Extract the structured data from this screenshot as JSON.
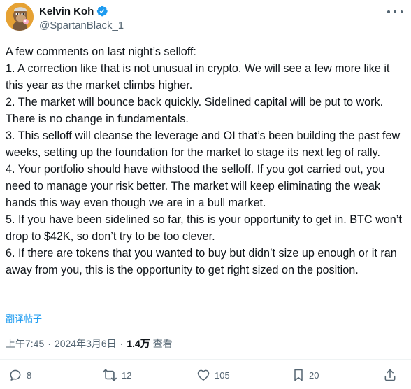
{
  "author": {
    "display_name": "Kelvin Koh",
    "handle": "@SpartanBlack_1",
    "verified": true
  },
  "tweet": {
    "text": "A few comments on last night’s selloff:\n1. A correction like that is not unusual in crypto. We will see a few more like it this year as the market climbs higher.\n2. The market will bounce back quickly. Sidelined capital will be put to work. There is no change in fundamentals.\n3. This selloff will cleanse the leverage and OI that’s been building the past few weeks, setting up the foundation for the market to stage its next leg of rally.\n4. Your portfolio should have withstood the selloff. If you got carried out, you need to manage your risk better. The market will keep eliminating the weak hands this way even though we are in a bull market.\n5. If you have been sidelined so far, this is your opportunity to get in. BTC won’t drop to $42K, so don’t try to be too clever.\n6. If there are tokens that you wanted to buy but didn’t size up enough or it ran away from you, this is the opportunity to get right sized on the position.",
    "translate_label": "翻译帖子"
  },
  "meta": {
    "time": "上午7:45",
    "separator": "·",
    "date": "2024年3月6日",
    "views_count": "1.4万",
    "views_label": "查看"
  },
  "actions": {
    "replies": "8",
    "reposts": "12",
    "likes": "105",
    "bookmarks": "20"
  },
  "colors": {
    "text": "#0f1419",
    "secondary": "#536471",
    "accent": "#1d9bf0",
    "divider": "#eff3f4"
  },
  "icons": {
    "avatar": "ape-avatar-icon",
    "verified": "verified-badge-icon",
    "more": "more-options-icon",
    "reply": "reply-icon",
    "repost": "repost-icon",
    "like": "heart-icon",
    "bookmark": "bookmark-icon",
    "share": "share-icon"
  }
}
